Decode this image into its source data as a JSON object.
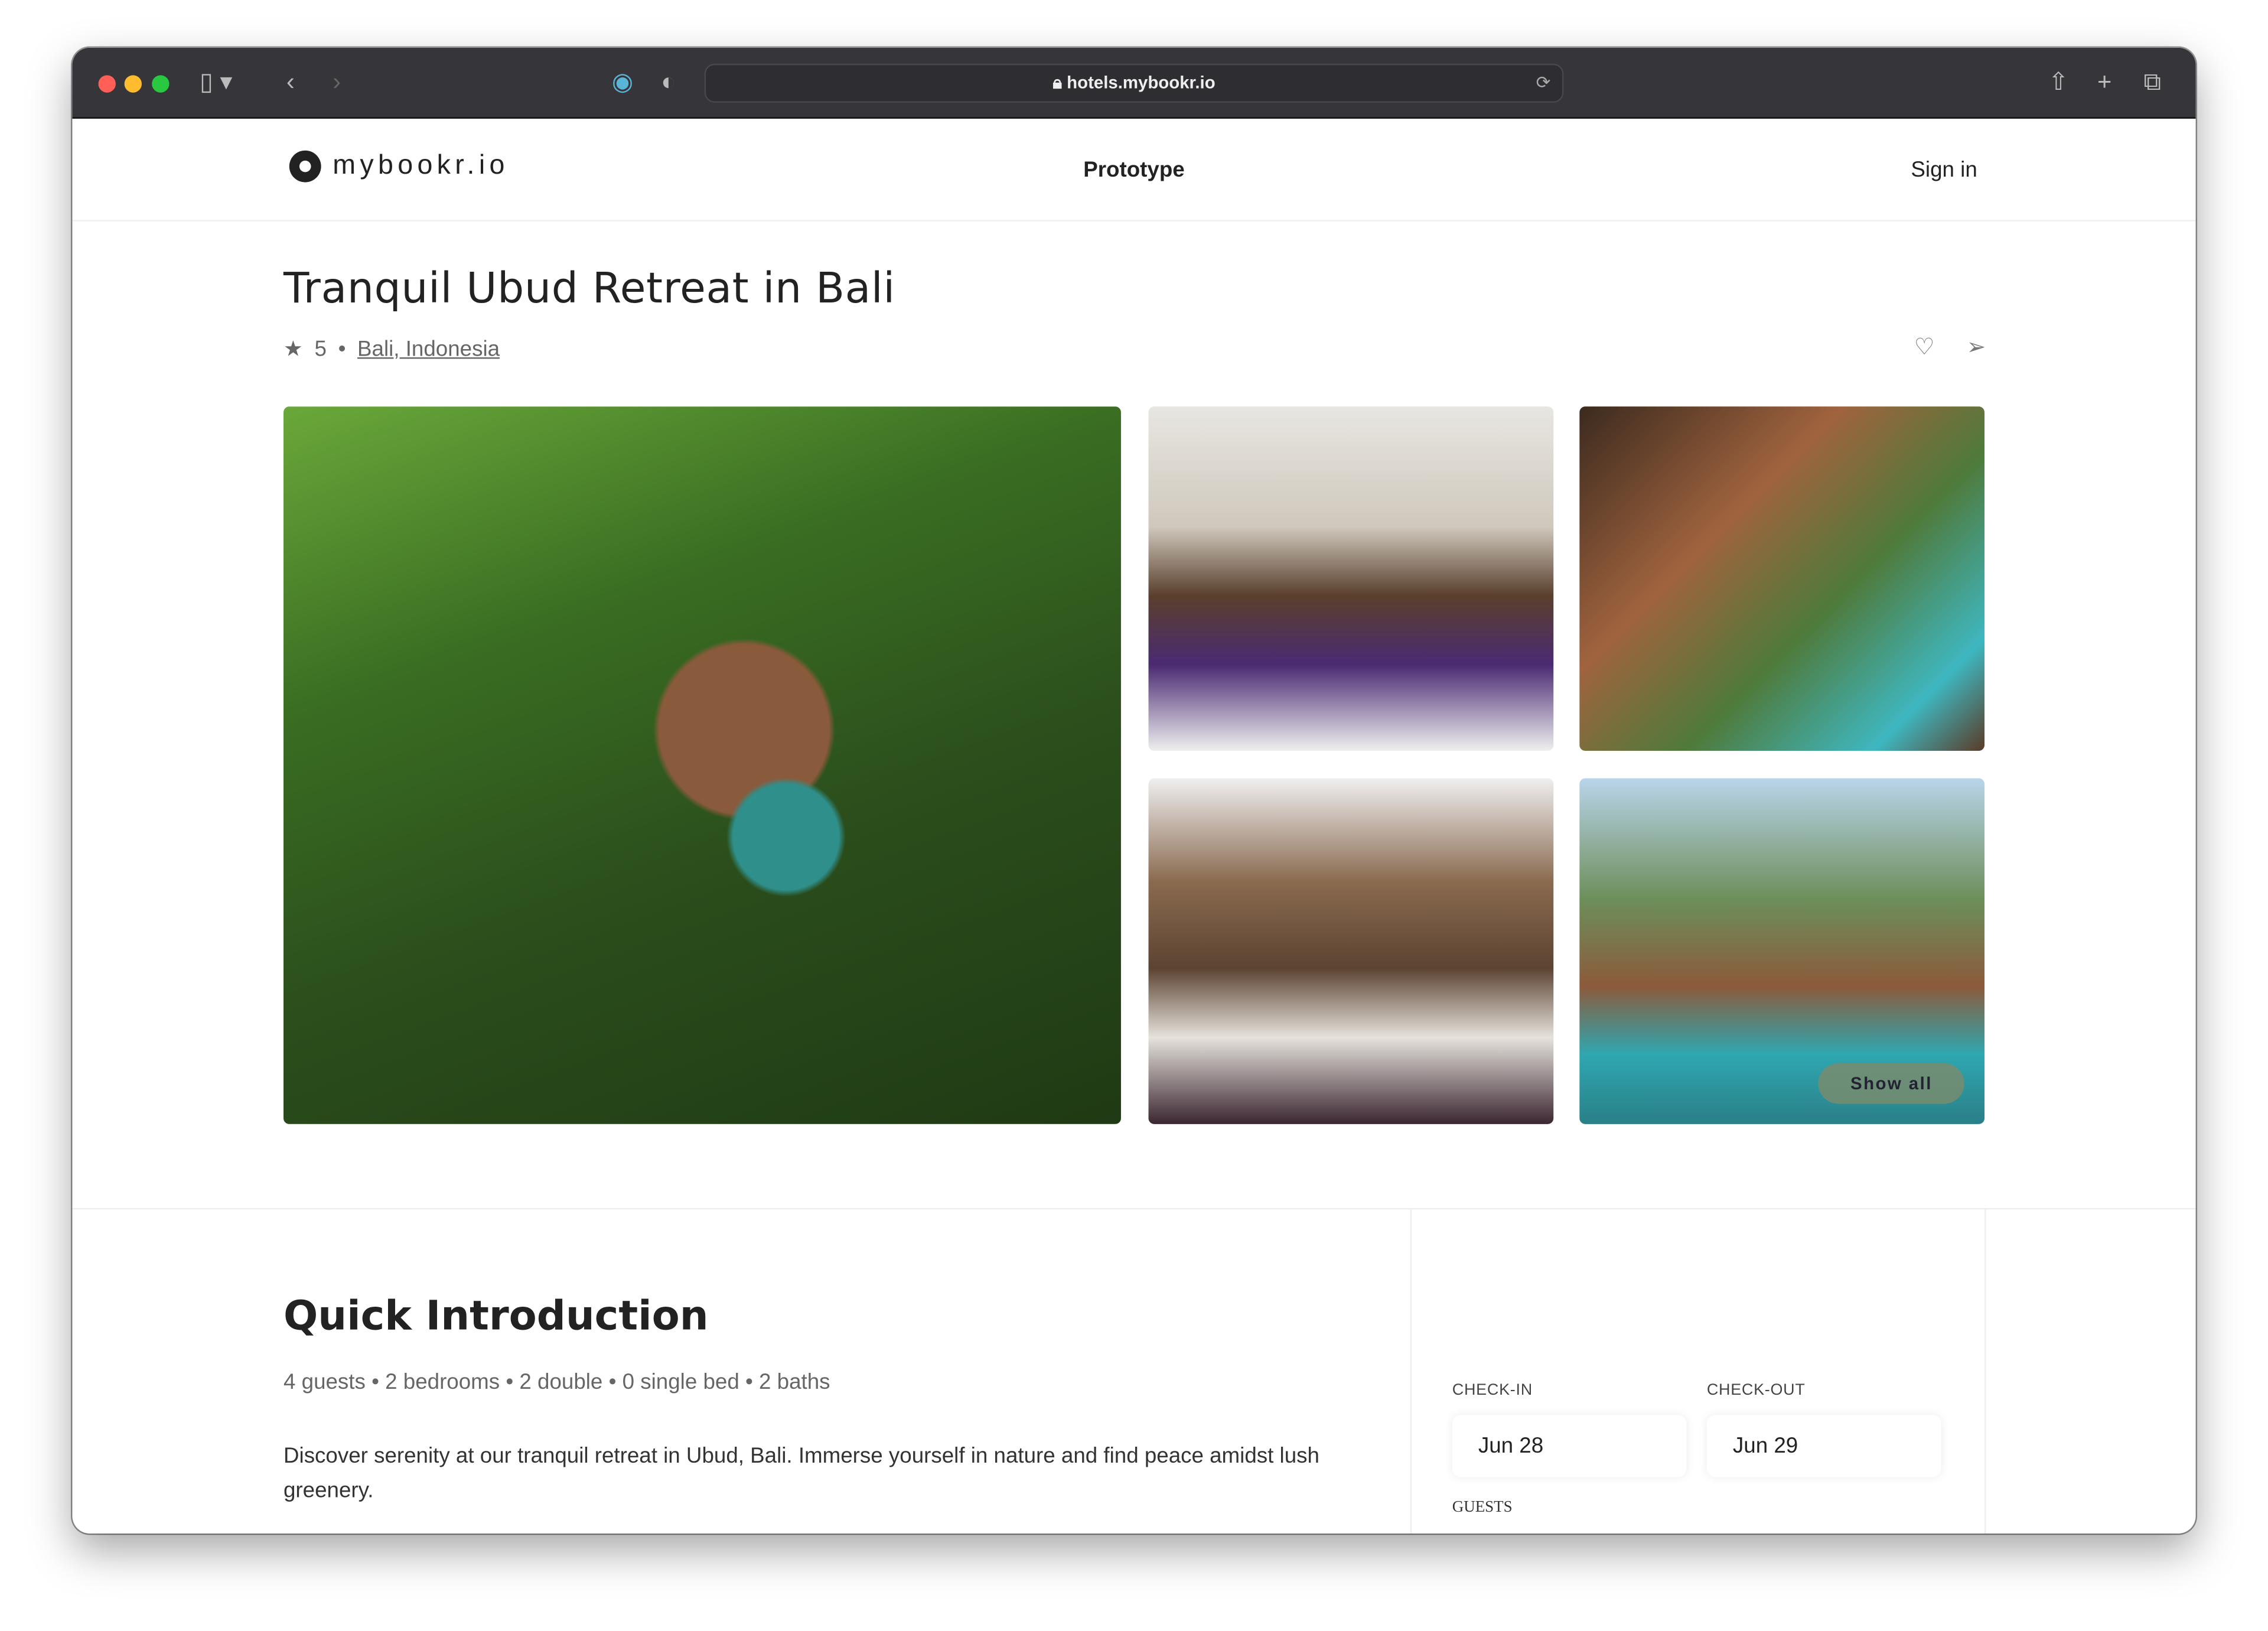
{
  "browser": {
    "url": "hotels.mybookr.io",
    "traffic_lights": [
      "#ff5f57",
      "#febc2e",
      "#28c840"
    ]
  },
  "header": {
    "logo": "mybookr.io",
    "center": "Prototype",
    "sign_in": "Sign in"
  },
  "listing": {
    "title": "Tranquil Ubud Retreat in Bali",
    "rating": "5",
    "location": "Bali, Indonesia",
    "show_all": "Show all",
    "photos": [
      "aerial-resort-rice-terraces",
      "canopy-bedroom-purple",
      "veranda-dining-pool",
      "wooden-bedroom",
      "garden-pool-lounge"
    ]
  },
  "intro": {
    "heading": "Quick Introduction",
    "details": "4 guests • 2 bedrooms • 2 double • 0 single bed • 2 baths",
    "description": "Discover serenity at our tranquil retreat in Ubud, Bali. Immerse yourself in nature and find peace amidst lush greenery."
  },
  "booking": {
    "checkin_label": "CHECK-IN",
    "checkin": "Jun 28",
    "checkout_label": "CHECK-OUT",
    "checkout": "Jun 29",
    "guests_label": "GUESTS"
  }
}
